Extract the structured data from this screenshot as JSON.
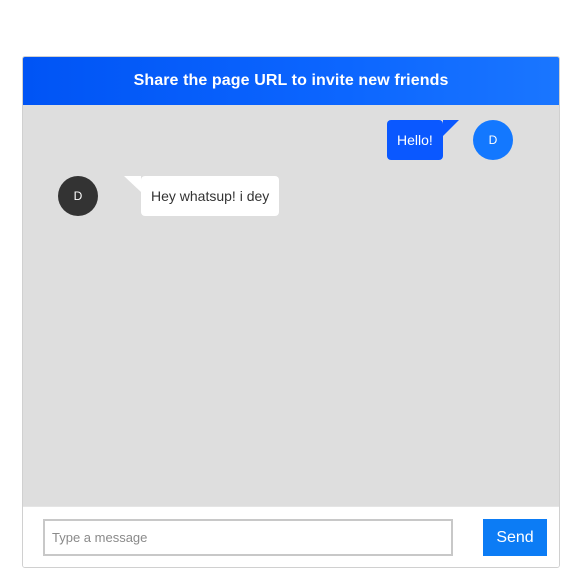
{
  "header": {
    "title": "Share the page URL to invite new friends"
  },
  "messages": [
    {
      "direction": "sent",
      "avatar_letter": "D",
      "text": "Hello!"
    },
    {
      "direction": "received",
      "avatar_letter": "D",
      "text": "Hey whatsup! i dey"
    }
  ],
  "composer": {
    "input_value": "",
    "input_placeholder": "Type a message",
    "send_label": "Send"
  },
  "colors": {
    "header_gradient_start": "#0054f5",
    "header_gradient_end": "#1a76ff",
    "sent_bubble": "#0a58ff",
    "my_avatar": "#1378ff",
    "other_avatar": "#333333",
    "messages_background": "#dedede",
    "send_button": "#0c7cf5"
  }
}
